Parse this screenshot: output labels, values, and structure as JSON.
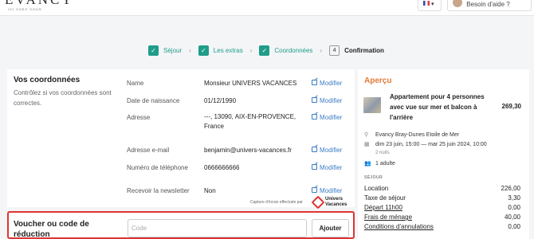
{
  "header": {
    "logo": "EVANCY",
    "tagline": "ICI CHEZ VOUS",
    "help_label": "Besoin d'aide ?"
  },
  "steps": [
    {
      "label": "Séjour",
      "done": true
    },
    {
      "label": "Les extras",
      "done": true
    },
    {
      "label": "Coordonnées",
      "done": true
    },
    {
      "number": "4",
      "label": "Confirmation",
      "done": false
    }
  ],
  "coords": {
    "title": "Vos coordonnées",
    "description": "Contrôlez si vos coordonnées sont correctes.",
    "edit_label": "Modifier",
    "rows": [
      {
        "label": "Name",
        "value": "Monsieur UNIVERS VACANCES"
      },
      {
        "label": "Date de naissance",
        "value": "01/12/1990"
      },
      {
        "label": "Adresse",
        "value": "---, 13090, AIX-EN-PROVENCE, France"
      },
      {
        "label": "Adresse e-mail",
        "value": "benjamin@univers-vacances.fr"
      },
      {
        "label": "Numéro de téléphone",
        "value": "0666666666"
      },
      {
        "label": "Recevoir la newsletter",
        "value": "Non"
      }
    ],
    "caption": "Capture d'écran effectuée par",
    "brand_line1": "Univers",
    "brand_line2": "Vacances"
  },
  "voucher": {
    "title": "Voucher ou code de réduction",
    "placeholder": "Code",
    "button": "Ajouter"
  },
  "apercu": {
    "title": "Aperçu",
    "property": "Appartement pour 4 personnes avec vue sur mer et balcon à l'arrière",
    "price": "269,30",
    "location": "Evancy Bray-Dunes Etoile de Mer",
    "dates": "dim 23 juin, 15:00 — mar 25 juin 2024, 10:00",
    "nights": "2 nuits",
    "guests": "1 adulte",
    "section": "SÉJOUR",
    "fees": [
      {
        "label": "Location",
        "value": "226,00",
        "underline": false
      },
      {
        "label": "Taxe de séjour",
        "value": "3,30",
        "underline": false
      },
      {
        "label": "Départ 11h00",
        "value": "0,00",
        "underline": true
      },
      {
        "label": "Frais de ménage",
        "value": "40,00",
        "underline": true
      },
      {
        "label": "Conditions d'annulations",
        "value": "0,00",
        "underline": true
      }
    ]
  }
}
